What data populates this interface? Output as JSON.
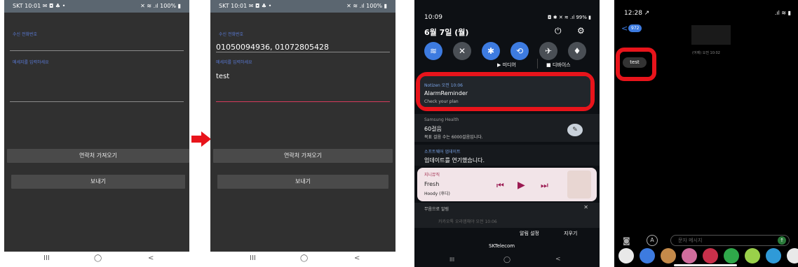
{
  "phone1": {
    "status_left": "SKT 10:01 ✉ ◘ ♣ •",
    "status_right": "✕ ≋ .ıl 100% ▮",
    "phone_label": "수신 전화번호",
    "phone_value": "",
    "message_label": "메세지를 입력하세요",
    "message_value": "",
    "contacts_button": "연락처 가져오기",
    "send_button": "보내기"
  },
  "phone2": {
    "status_left": "SKT 10:01 ✉ ◘ ♣ •",
    "status_right": "✕ ≋ .ıl 100% ▮",
    "phone_label": "수신 전화번호",
    "phone_value": "01050094936, 01072805428",
    "message_label": "메세지를 입력하세요",
    "message_value": "test",
    "contacts_button": "연락처 가져오기",
    "send_button": "보내기"
  },
  "phone3": {
    "time": "10:09",
    "status_right": "◘ ✱ ✕ ≋ .ıl 99% ▮",
    "date": "6월 7일 (월)",
    "media_label": "미디어",
    "devices_label": "디바이스",
    "notif1": {
      "app": "Notizen",
      "time": "오전 10:06",
      "title": "AlarmReminder",
      "body": "Check your plan"
    },
    "notif2": {
      "app": "Samsung Health",
      "title": "60걸음",
      "body": "목표 걸음 수는 6000걸음입니다."
    },
    "notif3": {
      "app": "소프트웨어 업데이트",
      "title": "업데이트를 연기했습니다."
    },
    "music": {
      "app": "지니뮤직",
      "title": "Fresh",
      "artist": "Hoody (후디)"
    },
    "silent_header": "무음으로 알림",
    "silent_item": "카카오톡 오라앱해야 오전 10:06",
    "settings_button": "알림 설정",
    "clear_button": "지우기",
    "carrier": "SKTelecom"
  },
  "phone4": {
    "time": "12:28 ↗",
    "back_count": "972",
    "timestamp": "(어제) 오전 10:02",
    "message": "test",
    "input_placeholder": "문자 메시지"
  },
  "colors": {
    "highlight": "#e8141b",
    "arrow": "#e8141b",
    "accent": "#3d7be0",
    "line_active": "#d63b5b"
  }
}
